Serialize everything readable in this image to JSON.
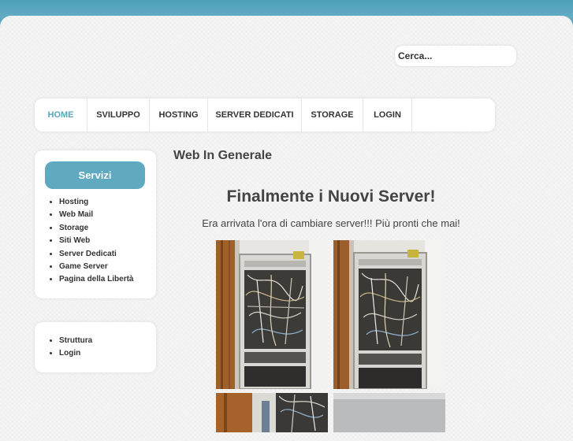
{
  "search": {
    "placeholder": "Cerca..."
  },
  "nav": {
    "items": [
      {
        "label": "HOME"
      },
      {
        "label": "SVILUPPO"
      },
      {
        "label": "HOSTING"
      },
      {
        "label": "SERVER DEDICATI"
      },
      {
        "label": "STORAGE"
      },
      {
        "label": "LOGIN"
      }
    ]
  },
  "sidebar": {
    "services_title": "Servizi",
    "services": [
      "Hosting",
      "Web Mail",
      "Storage",
      "Siti Web",
      "Server Dedicati",
      "Game Server",
      "Pagina della Libertà"
    ],
    "extra": [
      "Struttura",
      "Login"
    ]
  },
  "content": {
    "section_title": "Web In Generale",
    "article_title": "Finalmente i Nuovi Server!",
    "article_text": "Era arrivata l'ora di cambiare server!!! Più pronti che mai!"
  },
  "colors": {
    "accent": "#5fa9c1",
    "active_nav": "#5aa5bd",
    "page_bg": "#f5f5f5"
  }
}
